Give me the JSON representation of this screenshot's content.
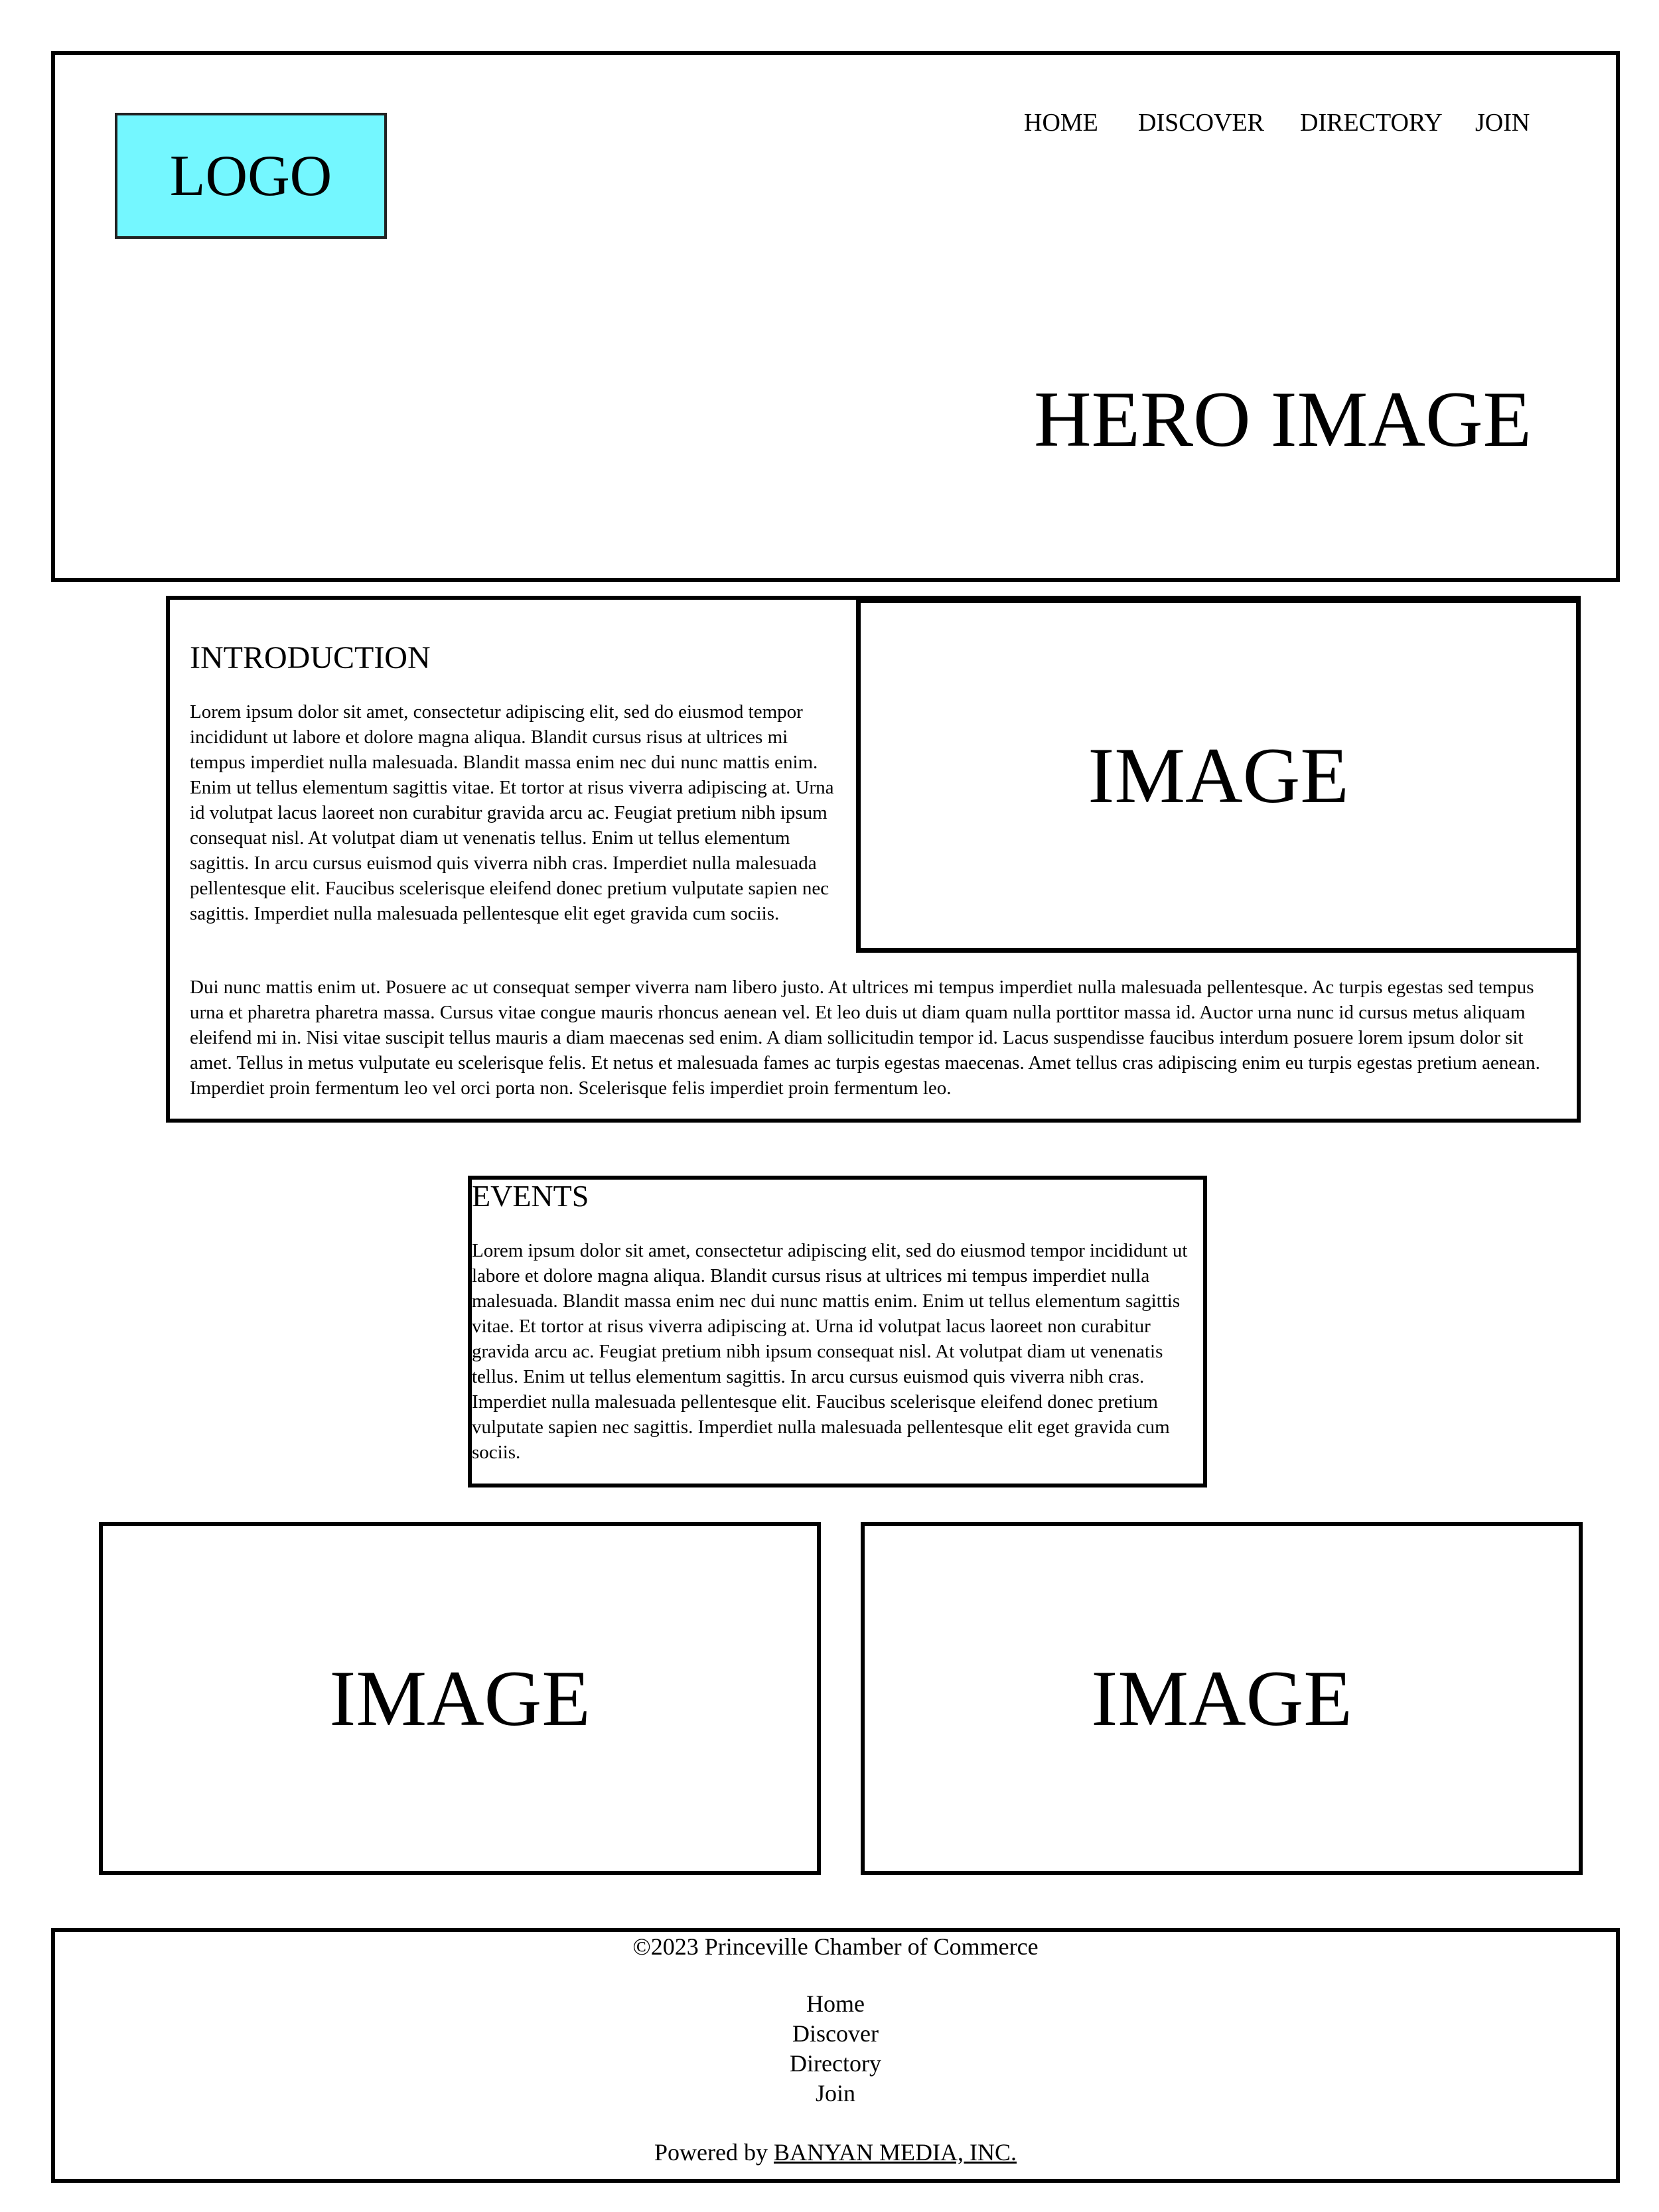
{
  "header": {
    "logo": "LOGO",
    "nav": [
      "HOME",
      "DISCOVER",
      "DIRECTORY",
      "JOIN"
    ],
    "hero_title": "HERO IMAGE"
  },
  "intro": {
    "title": "INTRODUCTION",
    "paragraph1": "Lorem ipsum dolor sit amet, consectetur adipiscing elit, sed do eiusmod tempor incididunt ut labore et dolore magna aliqua. Blandit cursus risus at ultrices mi tempus imperdiet nulla malesuada. Blandit massa enim nec dui nunc mattis enim. Enim ut tellus elementum sagittis vitae. Et tortor at risus viverra adipiscing at. Urna id volutpat lacus laoreet non curabitur gravida arcu ac. Feugiat pretium nibh ipsum consequat nisl. At volutpat diam ut venenatis tellus. Enim ut tellus elementum sagittis. In arcu cursus euismod quis viverra nibh cras. Imperdiet nulla malesuada pellentesque elit. Faucibus scelerisque eleifend donec pretium vulputate sapien nec sagittis. Imperdiet nulla malesuada pellentesque elit eget gravida cum sociis.",
    "image_label": "IMAGE",
    "paragraph2": "Dui nunc mattis enim ut. Posuere ac ut consequat semper viverra nam libero justo. At ultrices mi tempus imperdiet nulla malesuada pellentesque. Ac turpis egestas sed tempus urna et pharetra pharetra massa. Cursus vitae congue mauris rhoncus aenean vel. Et leo duis ut diam quam nulla porttitor massa id. Auctor urna nunc id cursus metus aliquam eleifend mi in. Nisi vitae suscipit tellus mauris a diam maecenas sed enim. A diam sollicitudin tempor id. Lacus suspendisse faucibus interdum posuere lorem ipsum dolor sit amet. Tellus in metus vulputate eu scelerisque felis. Et netus et malesuada fames ac turpis egestas maecenas. Amet tellus cras adipiscing enim eu turpis egestas pretium aenean. Imperdiet proin fermentum leo vel orci porta non. Scelerisque felis imperdiet proin fermentum leo."
  },
  "events": {
    "title": "EVENTS",
    "paragraph": "Lorem ipsum dolor sit amet, consectetur adipiscing elit, sed do eiusmod tempor incididunt ut labore et dolore magna aliqua. Blandit cursus risus at ultrices mi tempus imperdiet nulla malesuada. Blandit massa enim nec dui nunc mattis enim. Enim ut tellus elementum sagittis vitae. Et tortor at risus viverra adipiscing at. Urna id volutpat lacus laoreet non curabitur gravida arcu ac. Feugiat pretium nibh ipsum consequat nisl. At volutpat diam ut venenatis tellus. Enim ut tellus elementum sagittis. In arcu cursus euismod quis viverra nibh cras. Imperdiet nulla malesuada pellentesque elit. Faucibus scelerisque eleifend donec pretium vulputate sapien nec sagittis. Imperdiet nulla malesuada pellentesque elit eget gravida cum sociis."
  },
  "gallery": {
    "left_label": "IMAGE",
    "right_label": "IMAGE"
  },
  "footer": {
    "copyright": "©2023 Princeville Chamber of Commerce",
    "links": [
      "Home",
      "Discover",
      "Directory",
      "Join"
    ],
    "powered_prefix": "Powered by ",
    "powered_link": "BANYAN MEDIA, INC."
  },
  "colors": {
    "logo_background": "#74f7ff",
    "border": "#000000",
    "background": "#ffffff"
  }
}
